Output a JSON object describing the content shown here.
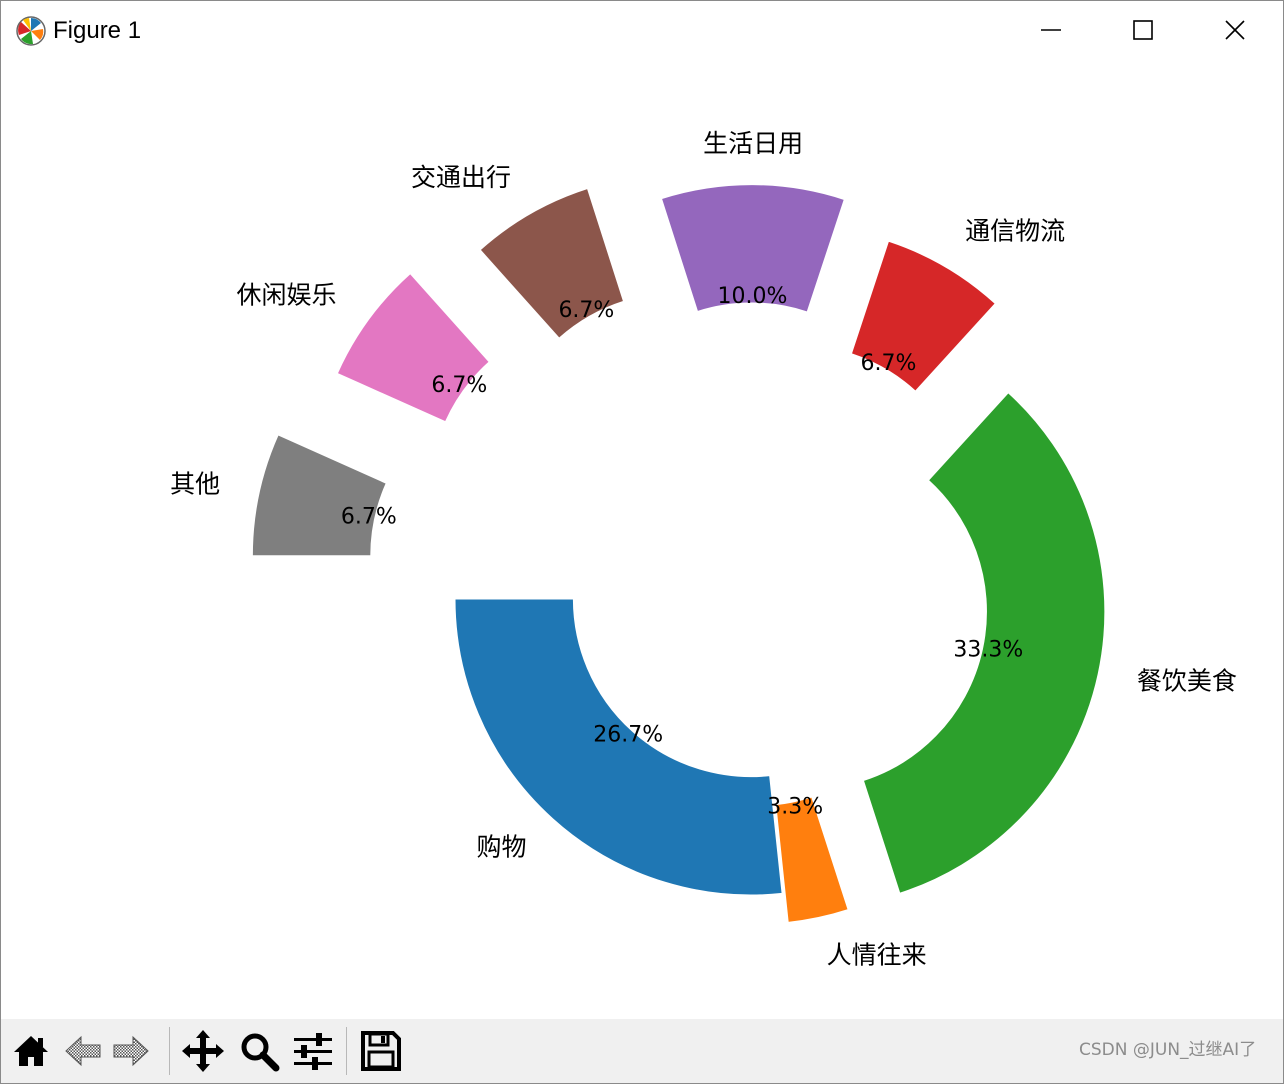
{
  "window": {
    "title": "Figure 1",
    "minimize_icon": "minimize-icon",
    "maximize_icon": "maximize-icon",
    "close_icon": "close-icon"
  },
  "toolbar": {
    "items": [
      {
        "name": "home",
        "icon": "home-icon"
      },
      {
        "name": "back",
        "icon": "back-arrow-icon"
      },
      {
        "name": "forward",
        "icon": "forward-arrow-icon"
      },
      {
        "name": "pan",
        "icon": "pan-arrows-icon"
      },
      {
        "name": "zoom",
        "icon": "zoom-magnifier-icon"
      },
      {
        "name": "configure-subplots",
        "icon": "sliders-icon"
      },
      {
        "name": "save",
        "icon": "save-floppy-icon"
      }
    ]
  },
  "watermark": "CSDN @JUN_过继AI了",
  "chart_data": {
    "type": "pie",
    "variant": "donut",
    "start_angle_deg": 180,
    "direction": "counterclockwise",
    "ring_width_fraction": 0.4,
    "slices": [
      {
        "label": "购物",
        "value": 26.7,
        "pct_label": "26.7%",
        "color": "#1f77b4",
        "explode": 0.0
      },
      {
        "label": "人情往来",
        "value": 3.3,
        "pct_label": "3.3%",
        "color": "#ff7f0e",
        "explode": 0.1
      },
      {
        "label": "餐饮美食",
        "value": 33.3,
        "pct_label": "33.3%",
        "color": "#2ca02c",
        "explode": 0.2
      },
      {
        "label": "通信物流",
        "value": 6.7,
        "pct_label": "6.7%",
        "color": "#d62728",
        "explode": 0.3
      },
      {
        "label": "生活日用",
        "value": 10.0,
        "pct_label": "10.0%",
        "color": "#9467bd",
        "explode": 0.4
      },
      {
        "label": "交通出行",
        "value": 6.7,
        "pct_label": "6.7%",
        "color": "#8c564b",
        "explode": 0.5
      },
      {
        "label": "休闲娱乐",
        "value": 6.7,
        "pct_label": "6.7%",
        "color": "#e377c2",
        "explode": 0.6
      },
      {
        "label": "其他",
        "value": 6.7,
        "pct_label": "6.7%",
        "color": "#7f7f7f",
        "explode": 0.7
      }
    ]
  }
}
